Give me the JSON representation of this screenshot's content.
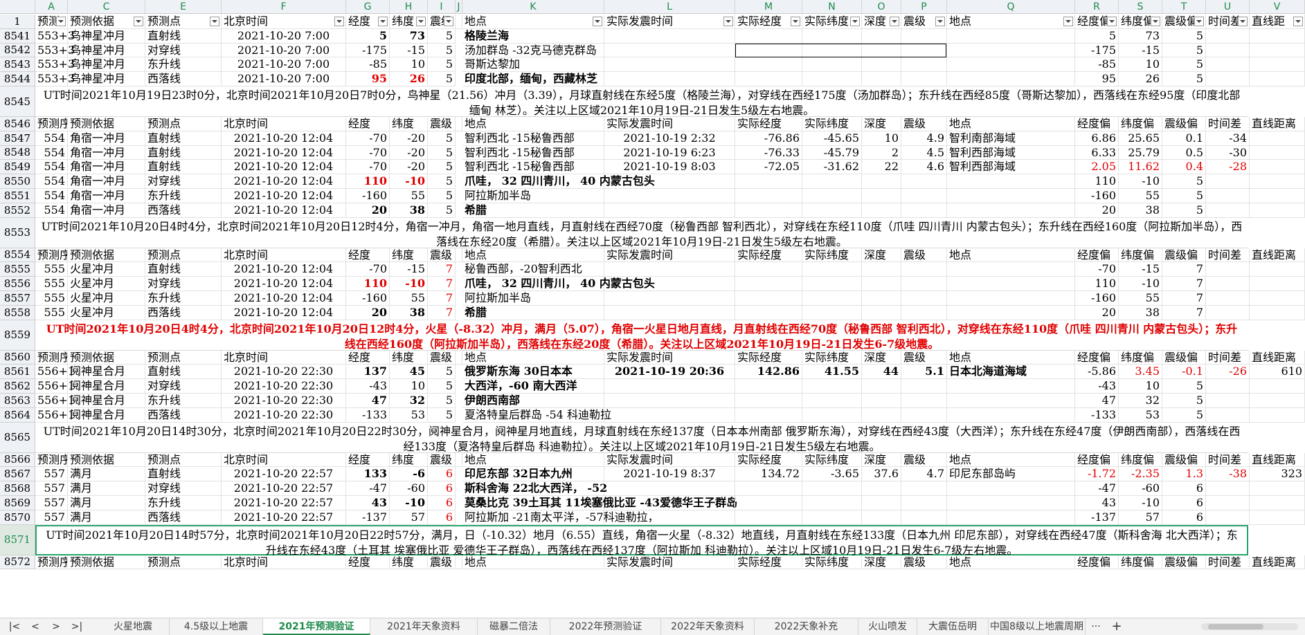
{
  "columns": [
    "A",
    "C",
    "E",
    "F",
    "G",
    "H",
    "I",
    "J",
    "K",
    "L",
    "M",
    "N",
    "O",
    "P",
    "Q",
    "R",
    "S",
    "T",
    "U",
    "V"
  ],
  "header_row": {
    "number": "1",
    "labels": [
      "预测",
      "预测依据",
      "预测点",
      "北京时间",
      "经度",
      "纬度",
      "震级",
      "",
      "地点",
      "实际发震时间",
      "实际经度",
      "实际纬度",
      "深度",
      "震级",
      "地点",
      "经度偏",
      "纬度偏",
      "震级偏",
      "时间差",
      "直线距"
    ]
  },
  "blocks": [
    {
      "rows": [
        {
          "n": "8541",
          "A": "553+3",
          "C": "鸟神星冲月",
          "E": "直射线",
          "F": "2021-10-20 7:00",
          "G": "5",
          "H": "73",
          "I": "5",
          "K": "格陵兰海",
          "R": "5",
          "S": "73",
          "T": "5"
        },
        {
          "n": "8542",
          "A": "553+3",
          "C": "鸟神星冲月",
          "E": "对穿线",
          "F": "2021-10-20 7:00",
          "G": "-175",
          "H": "-15",
          "I": "5",
          "K": "汤加群岛 -32克马德克群岛",
          "R": "-175",
          "S": "-15",
          "T": "5"
        },
        {
          "n": "8543",
          "A": "553+3",
          "C": "鸟神星冲月",
          "E": "东升线",
          "F": "2021-10-20 7:00",
          "G": "-85",
          "H": "10",
          "I": "5",
          "K": "哥斯达黎加",
          "R": "-85",
          "S": "10",
          "T": "5"
        },
        {
          "n": "8544",
          "A": "553+3",
          "C": "鸟神星冲月",
          "E": "西落线",
          "F": "2021-10-20 7:00",
          "G": "95",
          "H": "26",
          "I": "5",
          "K": "印度北部，缅甸，西藏林芝",
          "R": "95",
          "S": "26",
          "T": "5"
        }
      ],
      "summary_n": "8545",
      "summary": "UT时间2021年10月19日23时0分，北京时间2021年10月20日7时0分，鸟神星（21.56）冲月（3.39），月球直射线在东经5度（格陵兰海），对穿线在西经175度（汤加群岛）；东升线在西经85度（哥斯达黎加），西落线在东经95度（印度北部 缅甸 林芝）。关注以上区域2021年10月19日-21日发生5级左右地震。"
    },
    {
      "header_n": "8546",
      "rows": [
        {
          "n": "8547",
          "A": "554",
          "C": "角宿一冲月",
          "E": "直射线",
          "F": "2021-10-20 12:04",
          "G": "-70",
          "H": "-20",
          "I": "5",
          "K": "智利西北 -15秘鲁西部",
          "L": "2021-10-19 2:32",
          "M": "-76.86",
          "N": "-45.65",
          "O": "10",
          "P": "4.9",
          "Q": "智利南部海域",
          "R": "6.86",
          "S": "25.65",
          "T": "0.1",
          "U": "-34"
        },
        {
          "n": "8548",
          "A": "554",
          "C": "角宿一冲月",
          "E": "直射线",
          "F": "2021-10-20 12:04",
          "G": "-70",
          "H": "-20",
          "I": "5",
          "K": "智利西北 -15秘鲁西部",
          "L": "2021-10-19 6:23",
          "M": "-76.33",
          "N": "-45.79",
          "O": "2",
          "P": "4.5",
          "Q": "智利西部海域",
          "R": "6.33",
          "S": "25.79",
          "T": "0.5",
          "U": "-30"
        },
        {
          "n": "8549",
          "A": "554",
          "C": "角宿一冲月",
          "E": "直射线",
          "F": "2021-10-20 12:04",
          "G": "-70",
          "H": "-20",
          "I": "5",
          "K": "智利西北 -15秘鲁西部",
          "L": "2021-10-19 8:03",
          "M": "-72.05",
          "N": "-31.62",
          "O": "22",
          "P": "4.6",
          "Q": "智利西部海域",
          "R": "2.05",
          "S": "11.62",
          "T": "0.4",
          "U": "-28"
        },
        {
          "n": "8550",
          "A": "554",
          "C": "角宿一冲月",
          "E": "对穿线",
          "F": "2021-10-20 12:04",
          "G": "110",
          "H": "-10",
          "I": "5",
          "K": "爪哇， 32 四川青川， 40 内蒙古包头",
          "R": "110",
          "S": "-10",
          "T": "5"
        },
        {
          "n": "8551",
          "A": "554",
          "C": "角宿一冲月",
          "E": "东升线",
          "F": "2021-10-20 12:04",
          "G": "-160",
          "H": "55",
          "I": "5",
          "K": "阿拉斯加半岛",
          "R": "-160",
          "S": "55",
          "T": "5"
        },
        {
          "n": "8552",
          "A": "554",
          "C": "角宿一冲月",
          "E": "西落线",
          "F": "2021-10-20 12:04",
          "G": "20",
          "H": "38",
          "I": "5",
          "K": "希腊",
          "R": "20",
          "S": "38",
          "T": "5"
        }
      ],
      "summary_n": "8553",
      "summary": "UT时间2021年10月20日4时4分，北京时间2021年10月20日12时4分，角宿一冲月，角宿一地月直线，月直射线在西经70度（秘鲁西部 智利西北），对穿线在东经110度（爪哇 四川青川 内蒙古包头）；东升线在西经160度（阿拉斯加半岛），西落线在东经20度（希腊）。关注以上区域2021年10月19日-21日发生5级左右地震。"
    },
    {
      "header_n": "8554",
      "rows": [
        {
          "n": "8555",
          "A": "555",
          "C": "火星冲月",
          "E": "直射线",
          "F": "2021-10-20 12:04",
          "G": "-70",
          "H": "-15",
          "I": "7",
          "K": "秘鲁西部，-20智利西北",
          "R": "-70",
          "S": "-15",
          "T": "7"
        },
        {
          "n": "8556",
          "A": "555",
          "C": "火星冲月",
          "E": "对穿线",
          "F": "2021-10-20 12:04",
          "G": "110",
          "H": "-10",
          "I": "7",
          "K": "爪哇， 32 四川青川， 40 内蒙古包头",
          "R": "110",
          "S": "-10",
          "T": "7"
        },
        {
          "n": "8557",
          "A": "555",
          "C": "火星冲月",
          "E": "东升线",
          "F": "2021-10-20 12:04",
          "G": "-160",
          "H": "55",
          "I": "7",
          "K": "阿拉斯加半岛",
          "R": "-160",
          "S": "55",
          "T": "7"
        },
        {
          "n": "8558",
          "A": "555",
          "C": "火星冲月",
          "E": "西落线",
          "F": "2021-10-20 12:04",
          "G": "20",
          "H": "38",
          "I": "7",
          "K": "希腊",
          "R": "20",
          "S": "38",
          "T": "7"
        }
      ],
      "summary_n": "8559",
      "summary": "UT时间2021年10月20日4时4分，北京时间2021年10月20日12时4分，火星（-8.32）冲月，满月（5.07），角宿一火星日地月直线，月直射线在西经70度（秘鲁西部 智利西北），对穿线在东经110度（爪哇 四川青川 内蒙古包头）；东升线在西经160度（阿拉斯加半岛），西落线在东经20度（希腊）。关注以上区域2021年10月19日-21日发生6-7级地震。"
    },
    {
      "header_n": "8560",
      "rows": [
        {
          "n": "8561",
          "A": "556+1",
          "C": "阋神星合月",
          "E": "直射线",
          "F": "2021-10-20 22:30",
          "G": "137",
          "H": "45",
          "I": "5",
          "K": "俄罗斯东海 30日本本",
          "L": "2021-10-19 20:36",
          "M": "142.86",
          "N": "41.55",
          "O": "44",
          "P": "5.1",
          "Q": "日本北海道海域",
          "R": "-5.86",
          "S": "3.45",
          "T": "-0.1",
          "U": "-26",
          "V": "610"
        },
        {
          "n": "8562",
          "A": "556+1",
          "C": "阋神星合月",
          "E": "对穿线",
          "F": "2021-10-20 22:30",
          "G": "-43",
          "H": "10",
          "I": "5",
          "K": "大西洋，-60 南大西洋",
          "R": "-43",
          "S": "10",
          "T": "5"
        },
        {
          "n": "8563",
          "A": "556+1",
          "C": "阋神星合月",
          "E": "东升线",
          "F": "2021-10-20 22:30",
          "G": "47",
          "H": "32",
          "I": "5",
          "K": "伊朗西南部",
          "R": "47",
          "S": "32",
          "T": "5"
        },
        {
          "n": "8564",
          "A": "556+1",
          "C": "阋神星合月",
          "E": "西落线",
          "F": "2021-10-20 22:30",
          "G": "-133",
          "H": "53",
          "I": "5",
          "K": "夏洛特皇后群岛 -54 科迪勒拉",
          "R": "-133",
          "S": "53",
          "T": "5"
        }
      ],
      "summary_n": "8565",
      "summary": "UT时间2021年10月20日14时30分，北京时间2021年10月20日22时30分，阋神星合月，阋神星月地直线，月球直射线在东经137度（日本本州南部 俄罗斯东海），对穿线在西经43度（大西洋）；东升线在东经47度（伊朗西南部），西落线在西经133度（夏洛特皇后群岛 科迪勒拉）。关注以上区域2021年10月19日-21日发生5级左右地震。"
    },
    {
      "header_n": "8566",
      "rows": [
        {
          "n": "8567",
          "A": "557",
          "C": "满月",
          "E": "直射线",
          "F": "2021-10-20 22:57",
          "G": "133",
          "H": "-6",
          "I": "6",
          "K": "印尼东部 32日本九州",
          "L": "2021-10-19 8:37",
          "M": "134.72",
          "N": "-3.65",
          "O": "37.6",
          "P": "4.7",
          "Q": "印尼东部岛屿",
          "R": "-1.72",
          "S": "-2.35",
          "T": "1.3",
          "U": "-38",
          "V": "323"
        },
        {
          "n": "8568",
          "A": "557",
          "C": "满月",
          "E": "对穿线",
          "F": "2021-10-20 22:57",
          "G": "-47",
          "H": "-60",
          "I": "6",
          "K": "斯科舍海 22北大西洋， -52",
          "R": "-47",
          "S": "-60",
          "T": "6"
        },
        {
          "n": "8569",
          "A": "557",
          "C": "满月",
          "E": "东升线",
          "F": "2021-10-20 22:57",
          "G": "43",
          "H": "-10",
          "I": "6",
          "K": "莫桑比克 39土耳其 11埃塞俄比亚 -43爱德华王子群岛",
          "R": "43",
          "S": "-10",
          "T": "6"
        },
        {
          "n": "8570",
          "A": "557",
          "C": "满月",
          "E": "西落线",
          "F": "2021-10-20 22:57",
          "G": "-137",
          "H": "57",
          "I": "6",
          "K": "阿拉斯加 -21南太平洋，-57科迪勒拉，",
          "R": "-137",
          "S": "57",
          "T": "6"
        }
      ],
      "summary_n": "8571",
      "summary": "UT时间2021年10月20日14时57分，北京时间2021年10月20日22时57分，满月，日（-10.32）地月（6.55）直线，角宿一火星（-8.32）地直线，月直射线在东经133度（日本九州 印尼东部），对穿线在西经47度（斯科舍海 北大西洋）；东升线在东经43度（土耳其 埃塞俄比亚 爱德华王子群岛），西落线在西经137度（阿拉斯加 科迪勒拉）。关注以上区域10月19日-21日发生6-7级左右地震。"
    },
    {
      "header_n": "8572",
      "rows": []
    }
  ],
  "subheader_labels": [
    "预测序",
    "预测依据",
    "预测点",
    "北京时间",
    "经度",
    "纬度",
    "震级",
    "",
    "地点",
    "实际发震时间",
    "实际经度",
    "实际纬度",
    "深度",
    "震级",
    "地点",
    "经度偏",
    "纬度偏",
    "震级偏",
    "时间差",
    "直线距离"
  ],
  "tabs": [
    "火星地震",
    "4.5级以上地震",
    "2021年预测验证",
    "2021年天象资料",
    "磁暴二倍法",
    "2022年预测验证",
    "2022年天象资料",
    "2022天象补充",
    "火山喷发",
    "大震伍岳明",
    "中国8级以上地震周期"
  ],
  "active_tab": "2021年预测验证",
  "nav": {
    "first": "|<",
    "prev": "<",
    "next": ">",
    "last": ">|",
    "more": "···",
    "add": "+"
  },
  "colors": {
    "accent": "#1f8a4c",
    "red": "#e00000",
    "selection": "#27a56a"
  }
}
